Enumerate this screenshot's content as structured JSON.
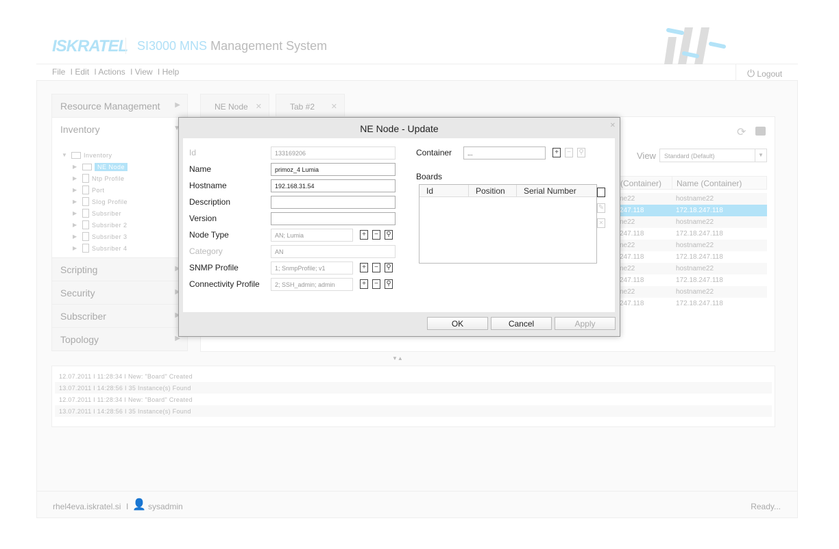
{
  "header": {
    "logo": "ISKRATEL",
    "title_accent": "SI3000 MNS",
    "title": "Management System",
    "logout": "Logout"
  },
  "menu": [
    "File",
    "Edit",
    "Actions",
    "View",
    "Help"
  ],
  "sidebar": {
    "sections": [
      "Resource Management",
      "Inventory",
      "Scripting",
      "Security",
      "Subscriber",
      "Topology"
    ],
    "tree": {
      "root": "Inventory",
      "items": [
        "NE Node",
        "Ntp Profile",
        "Port",
        "Slog Profile",
        "Subsriber",
        "Subsriber 2",
        "Subsriber 3",
        "Subsriber 4"
      ]
    }
  },
  "tabs": [
    "NE Node",
    "Tab #2"
  ],
  "main": {
    "view_label": "View",
    "view_value": "Standard (Default)",
    "columns": [
      "(Container)",
      "Name (Container)"
    ],
    "rows": [
      [
        "ne22",
        "hostname22"
      ],
      [
        "247.118",
        "172.18.247.118"
      ],
      [
        "ne22",
        "hostname22"
      ],
      [
        "247.118",
        "172.18.247.118"
      ],
      [
        "ne22",
        "hostname22"
      ],
      [
        "247.118",
        "172.18.247.118"
      ],
      [
        "ne22",
        "hostname22"
      ],
      [
        "247.118",
        "172.18.247.118"
      ],
      [
        "ne22",
        "hostname22"
      ],
      [
        "247.118",
        "172.18.247.118"
      ]
    ]
  },
  "dialog": {
    "title": "NE Node - Update",
    "fields": {
      "id": {
        "label": "Id",
        "value": "133169206"
      },
      "name": {
        "label": "Name",
        "value": "primoz_4 Lumia"
      },
      "hostname": {
        "label": "Hostname",
        "value": "192.168.31.54"
      },
      "description": {
        "label": "Description",
        "value": ""
      },
      "version": {
        "label": "Version",
        "value": ""
      },
      "node_type": {
        "label": "Node Type",
        "value": "AN; Lumia"
      },
      "category": {
        "label": "Category",
        "value": "AN"
      },
      "snmp": {
        "label": "SNMP Profile",
        "value": "1; SnmpProfile; v1"
      },
      "connectivity": {
        "label": "Connectivity Profile",
        "value": "2; SSH_admin; admin"
      },
      "container": {
        "label": "Container",
        "value": "..."
      }
    },
    "boards": {
      "label": "Boards",
      "columns": [
        "Id",
        "Position",
        "Serial Number"
      ]
    },
    "buttons": {
      "ok": "OK",
      "cancel": "Cancel",
      "apply": "Apply"
    }
  },
  "log": [
    "12.07.2011  I  11:28:34  I  New: \"Board\" Created",
    "13.07.2011  I  14:28:56  I  35 Instance(s) Found",
    "12.07.2011  I  11:28:34  I  New: \"Board\" Created",
    "13.07.2011  I  14:28:56  I  35 Instance(s) Found"
  ],
  "footer": {
    "host": "rhel4eva.iskratel.si",
    "user": "sysadmin",
    "status": "Ready..."
  },
  "colors": {
    "accent": "#b3e3f8"
  }
}
